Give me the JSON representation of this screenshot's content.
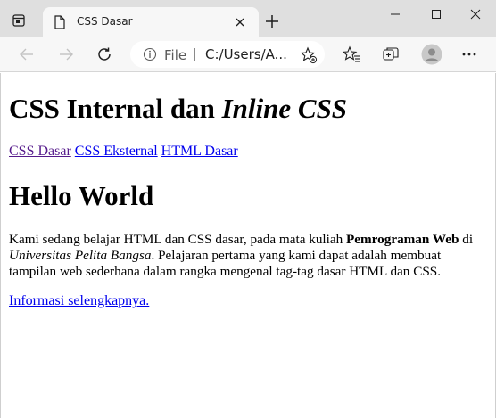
{
  "browser": {
    "tab": {
      "title": "CSS Dasar"
    },
    "address": {
      "scheme_label": "File",
      "url": "C:/Users/A..."
    }
  },
  "page": {
    "title_part1": "CSS Internal dan ",
    "title_part2": "Inline CSS",
    "nav_links": [
      {
        "label": "CSS Dasar",
        "visited": true
      },
      {
        "label": "CSS Eksternal",
        "visited": false
      },
      {
        "label": "HTML Dasar",
        "visited": false
      }
    ],
    "heading": "Hello World",
    "paragraph": {
      "t1": "Kami sedang belajar HTML dan CSS dasar, pada mata kuliah ",
      "bold": "Pemrograman Web",
      "t2": " di ",
      "italic": "Universitas Pelita Bangsa",
      "t3": ". Pelajaran pertama yang kami dapat adalah membuat tampilan web sederhana dalam rangka mengenal tag-tag dasar HTML dan CSS."
    },
    "more_link": "Informasi selengkapnya."
  },
  "icons": {
    "tab_actions": "tab-actions-icon",
    "favicon": "page-icon",
    "close": "close-icon",
    "new_tab": "plus-icon",
    "minimize": "minimize-icon",
    "maximize": "maximize-icon",
    "window_close": "window-close-icon",
    "back": "back-arrow-icon",
    "forward": "forward-arrow-icon",
    "reload": "reload-icon",
    "info": "info-icon",
    "add_favorite": "star-add-icon",
    "favorites": "favorites-icon",
    "collections": "collections-icon",
    "profile": "profile-avatar-icon",
    "menu": "more-menu-icon"
  },
  "colors": {
    "link": "#0000ee",
    "visited_link": "#551a8b",
    "tabstrip": "#dfdfdf",
    "toolbar": "#f7f7f7"
  }
}
